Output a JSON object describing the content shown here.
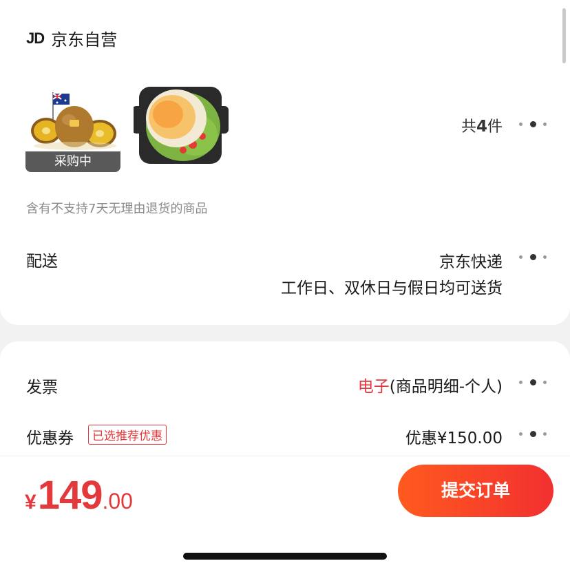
{
  "store": {
    "logo": "JD",
    "name": "京东自营"
  },
  "products": {
    "items": [
      {
        "name": "kiwi-fruit",
        "tag": "采购中"
      },
      {
        "name": "grill-pan-dish",
        "tag": ""
      }
    ],
    "count_prefix": "共",
    "count": "4",
    "count_suffix": "件"
  },
  "notice": "含有不支持7天无理由退货的商品",
  "delivery": {
    "label": "配送",
    "method": "京东快递",
    "schedule": "工作日、双休日与假日均可送货"
  },
  "invoice": {
    "label": "发票",
    "type": "电子",
    "detail": "(商品明细-个人)"
  },
  "coupon": {
    "label": "优惠券",
    "badge": "已选推荐优惠",
    "value": "优惠¥150.00"
  },
  "footer": {
    "currency": "¥",
    "price_int": "149",
    "price_dec": ".00",
    "submit_label": "提交订单"
  },
  "colors": {
    "accent": "#e4393c",
    "button_start": "#ff5a1f",
    "button_end": "#f23030"
  },
  "icons": [
    "more-dots-icon",
    "australia-flag-icon"
  ]
}
